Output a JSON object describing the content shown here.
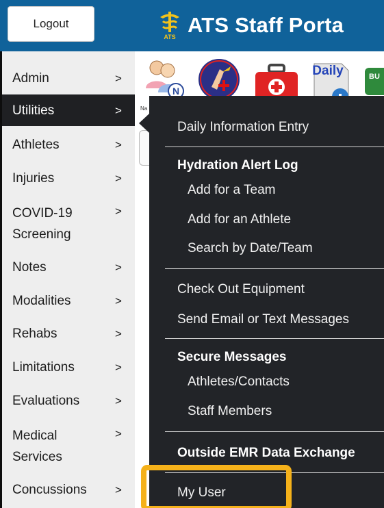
{
  "header": {
    "logout_label": "Logout",
    "brand_title": "ATS Staff Porta",
    "logo_text": "ATS",
    "background_color": "#10629a"
  },
  "sidebar": {
    "items": [
      {
        "label": "Admin",
        "chevron": ">"
      },
      {
        "label": "Utilities",
        "chevron": ">",
        "active": true
      },
      {
        "label": "Athletes",
        "chevron": ">"
      },
      {
        "label": "Injuries",
        "chevron": ">"
      },
      {
        "label": "COVID-19 Screening",
        "chevron": ">"
      },
      {
        "label": "Notes",
        "chevron": ">"
      },
      {
        "label": "Modalities",
        "chevron": ">"
      },
      {
        "label": "Rehabs",
        "chevron": ">"
      },
      {
        "label": "Limitations",
        "chevron": ">"
      },
      {
        "label": "Evaluations",
        "chevron": ">"
      },
      {
        "label": "Medical Services",
        "chevron": ">"
      },
      {
        "label": "Concussions",
        "chevron": ">"
      }
    ]
  },
  "toolbar": {
    "icons": [
      "users-icon",
      "heal-icon",
      "first-aid-kit-icon",
      "daily-info-icon",
      "bulletin-icon"
    ],
    "daily_label": "Daily",
    "bulletin_label": "BU",
    "tiny_label": "Na"
  },
  "dropdown": {
    "items": {
      "daily_info": "Daily Information Entry",
      "hydration_header": "Hydration Alert Log",
      "add_team": "Add for a Team",
      "add_athlete": "Add for an Athlete",
      "search_date_team": "Search by Date/Team",
      "check_out": "Check Out Equipment",
      "send_email": "Send Email or Text Messages",
      "secure_header": "Secure Messages",
      "athletes_contacts": "Athletes/Contacts",
      "staff_members": "Staff Members",
      "emr_header": "Outside EMR Data Exchange",
      "my_user": "My User"
    }
  },
  "colors": {
    "menu_bg": "#222428",
    "highlight": "#f5b11a",
    "sidebar_bg": "#eeeeee"
  }
}
